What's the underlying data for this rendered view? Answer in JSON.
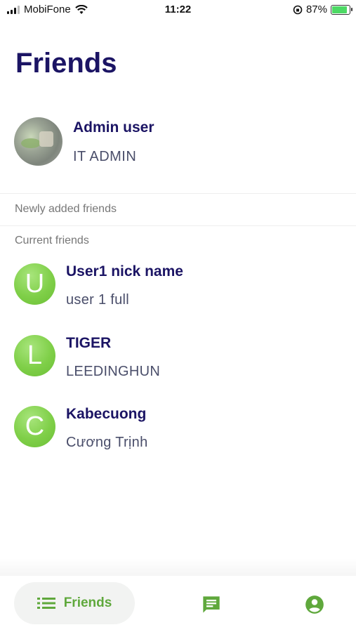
{
  "status_bar": {
    "carrier": "MobiFone",
    "time": "11:22",
    "battery": "87%"
  },
  "page": {
    "title": "Friends"
  },
  "admin": {
    "name": "Admin user",
    "subtitle": "IT ADMIN"
  },
  "sections": {
    "newly_added": "Newly added friends",
    "current": "Current friends"
  },
  "friends": [
    {
      "initial": "U",
      "nickname": "User1 nick name",
      "fullname": "user 1 full"
    },
    {
      "initial": "L",
      "nickname": "TIGER",
      "fullname": "LEEDINGHUN"
    },
    {
      "initial": "C",
      "nickname": "Kabecuong",
      "fullname": "Cương Trịnh"
    }
  ],
  "bottom_nav": {
    "friends_label": "Friends",
    "items": [
      {
        "icon": "list-icon",
        "active": true
      },
      {
        "icon": "chat-icon",
        "active": false
      },
      {
        "icon": "account-circle-icon",
        "active": false
      }
    ],
    "accent_color": "#5fa83c"
  },
  "colors": {
    "title": "#1b1464",
    "avatar_green": "#7fcf48"
  }
}
